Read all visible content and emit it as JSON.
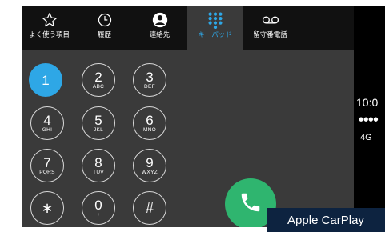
{
  "tabs": [
    {
      "label": "よく使う項目",
      "icon": "star-icon",
      "active": false
    },
    {
      "label": "履歴",
      "icon": "clock-icon",
      "active": false
    },
    {
      "label": "連絡先",
      "icon": "contact-icon",
      "active": false
    },
    {
      "label": "キーパッド",
      "icon": "keypad-icon",
      "active": true
    },
    {
      "label": "留守番電話",
      "icon": "voicemail-icon",
      "active": false
    }
  ],
  "keypad": {
    "keys": [
      {
        "digit": "1",
        "letters": ""
      },
      {
        "digit": "2",
        "letters": "ABC"
      },
      {
        "digit": "3",
        "letters": "DEF"
      },
      {
        "digit": "4",
        "letters": "GHI"
      },
      {
        "digit": "5",
        "letters": "JKL"
      },
      {
        "digit": "6",
        "letters": "MNO"
      },
      {
        "digit": "7",
        "letters": "PQRS"
      },
      {
        "digit": "8",
        "letters": "TUV"
      },
      {
        "digit": "9",
        "letters": "WXYZ"
      },
      {
        "digit": "∗",
        "letters": ""
      },
      {
        "digit": "0",
        "letters": "+"
      },
      {
        "digit": "#",
        "letters": ""
      }
    ],
    "selected_key": "1"
  },
  "call_button": {
    "icon": "phone-icon"
  },
  "status": {
    "time": "10:0",
    "signal": "●●●●",
    "network": "4G"
  },
  "badge": {
    "text": "Apple CarPlay"
  },
  "colors": {
    "accent": "#2ea7e6",
    "call_green": "#2fb56f",
    "tabbar_bg": "#111111",
    "screen_bg": "#3a3a3a",
    "badge_bg": "#0d2340"
  }
}
